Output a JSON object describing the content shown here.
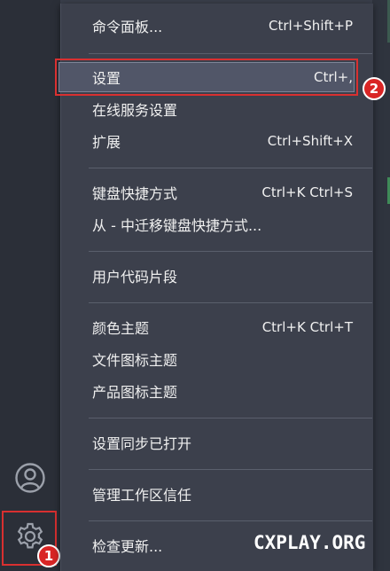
{
  "colors": {
    "menu_bg": "#3c404c",
    "activity_bar_bg": "#2b2f38",
    "highlight_border": "#d93030",
    "badge_bg": "#d92525",
    "selected_bg": "#515668",
    "text": "#f0f0f0"
  },
  "menu": {
    "groups": [
      {
        "items": [
          {
            "label": "命令面板...",
            "shortcut": "Ctrl+Shift+P"
          }
        ]
      },
      {
        "items": [
          {
            "label": "设置",
            "shortcut": "Ctrl+,",
            "selected": true
          },
          {
            "label": "在线服务设置",
            "shortcut": ""
          },
          {
            "label": "扩展",
            "shortcut": "Ctrl+Shift+X"
          }
        ]
      },
      {
        "items": [
          {
            "label": "键盘快捷方式",
            "shortcut": "Ctrl+K Ctrl+S"
          },
          {
            "label": "从 - 中迁移键盘快捷方式...",
            "shortcut": ""
          }
        ]
      },
      {
        "items": [
          {
            "label": "用户代码片段",
            "shortcut": ""
          }
        ]
      },
      {
        "items": [
          {
            "label": "颜色主题",
            "shortcut": "Ctrl+K Ctrl+T"
          },
          {
            "label": "文件图标主题",
            "shortcut": ""
          },
          {
            "label": "产品图标主题",
            "shortcut": ""
          }
        ]
      },
      {
        "items": [
          {
            "label": "设置同步已打开",
            "shortcut": ""
          }
        ]
      },
      {
        "items": [
          {
            "label": "管理工作区信任",
            "shortcut": ""
          }
        ]
      },
      {
        "items": [
          {
            "label": "检查更新...",
            "shortcut": ""
          }
        ]
      }
    ]
  },
  "activity_bar": {
    "account_icon": "account-icon",
    "gear_icon": "gear-icon"
  },
  "annotations": {
    "badge_1": "1",
    "badge_2": "2"
  },
  "watermark": "CXPLAY.ORG"
}
